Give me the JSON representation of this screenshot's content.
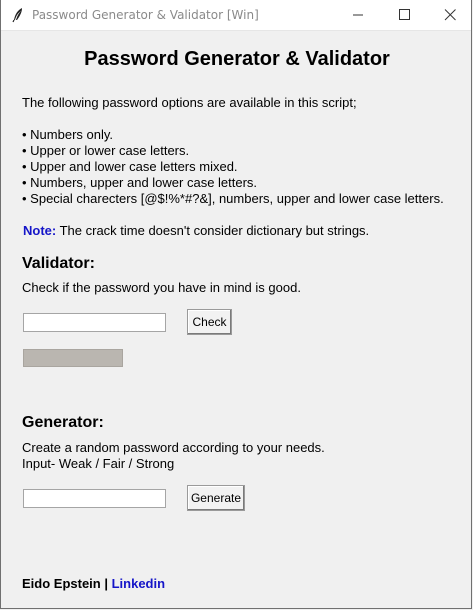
{
  "window": {
    "title": "Password Generator & Validator [Win]"
  },
  "header": {
    "title": "Password Generator & Validator"
  },
  "intro": {
    "text": "The following password options are available in this script;",
    "options": [
      "• Numbers only.",
      "• Upper or lower case letters.",
      "• Upper and lower case letters mixed.",
      "• Numbers, upper and lower case letters.",
      "• Special charecters [@$!%*#?&], numbers, upper and lower case letters."
    ],
    "note_label": "Note:",
    "note_text": " The crack time doesn't consider dictionary but strings."
  },
  "validator": {
    "title": "Validator:",
    "description": "Check if the password you have in mind is good.",
    "input_value": "",
    "button_label": "Check",
    "strength_bar_color": "#bab6b0"
  },
  "generator": {
    "title": "Generator:",
    "description_line1": "Create a random password according to your needs.",
    "description_line2": "Input- Weak / Fair / Strong",
    "input_value": "",
    "button_label": "Generate"
  },
  "footer": {
    "author": "Eido Epstein | ",
    "link_label": "Linkedin",
    "link_color": "#1515c8"
  },
  "icons": [
    "feather-icon",
    "minimize-icon",
    "maximize-icon",
    "close-icon"
  ]
}
